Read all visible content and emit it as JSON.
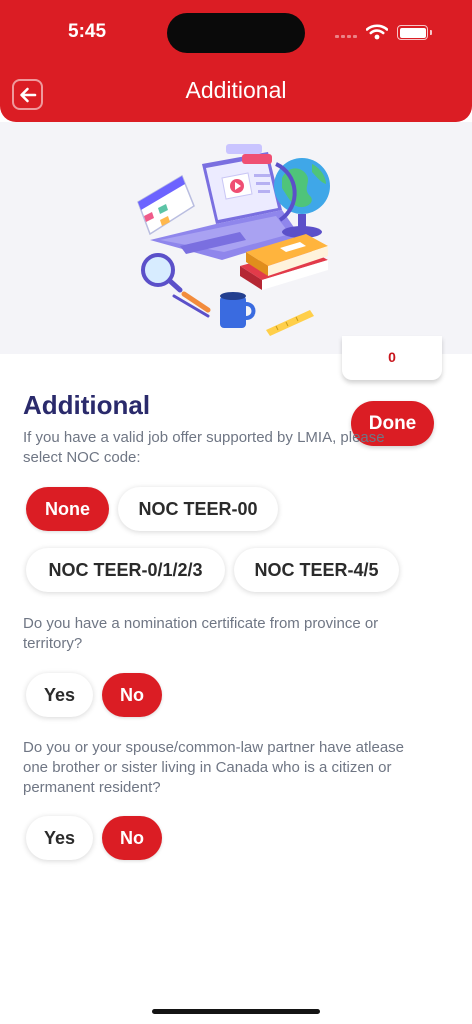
{
  "status_bar": {
    "time": "5:45"
  },
  "header": {
    "title": "Additional"
  },
  "score": {
    "value": "0"
  },
  "section": {
    "title": "Additional",
    "done_label": "Done"
  },
  "questions": {
    "noc": {
      "text": "If you have a valid job offer supported by LMIA, please select NOC code:",
      "options": [
        "None",
        "NOC TEER-00",
        "NOC TEER-0/1/2/3",
        "NOC TEER-4/5"
      ],
      "selected": "None"
    },
    "nomination": {
      "text": "Do you have a nomination certificate from province or territory?",
      "options": [
        "Yes",
        "No"
      ],
      "selected": "No"
    },
    "sibling": {
      "text": "Do you or your spouse/common-law partner have atlease one brother or sister living in Canada who is a citizen or permanent resident?",
      "options": [
        "Yes",
        "No"
      ],
      "selected": "No"
    }
  },
  "colors": {
    "brand_red": "#db1d24",
    "title_navy": "#2a2a6b",
    "question_gray": "#6f7684"
  }
}
